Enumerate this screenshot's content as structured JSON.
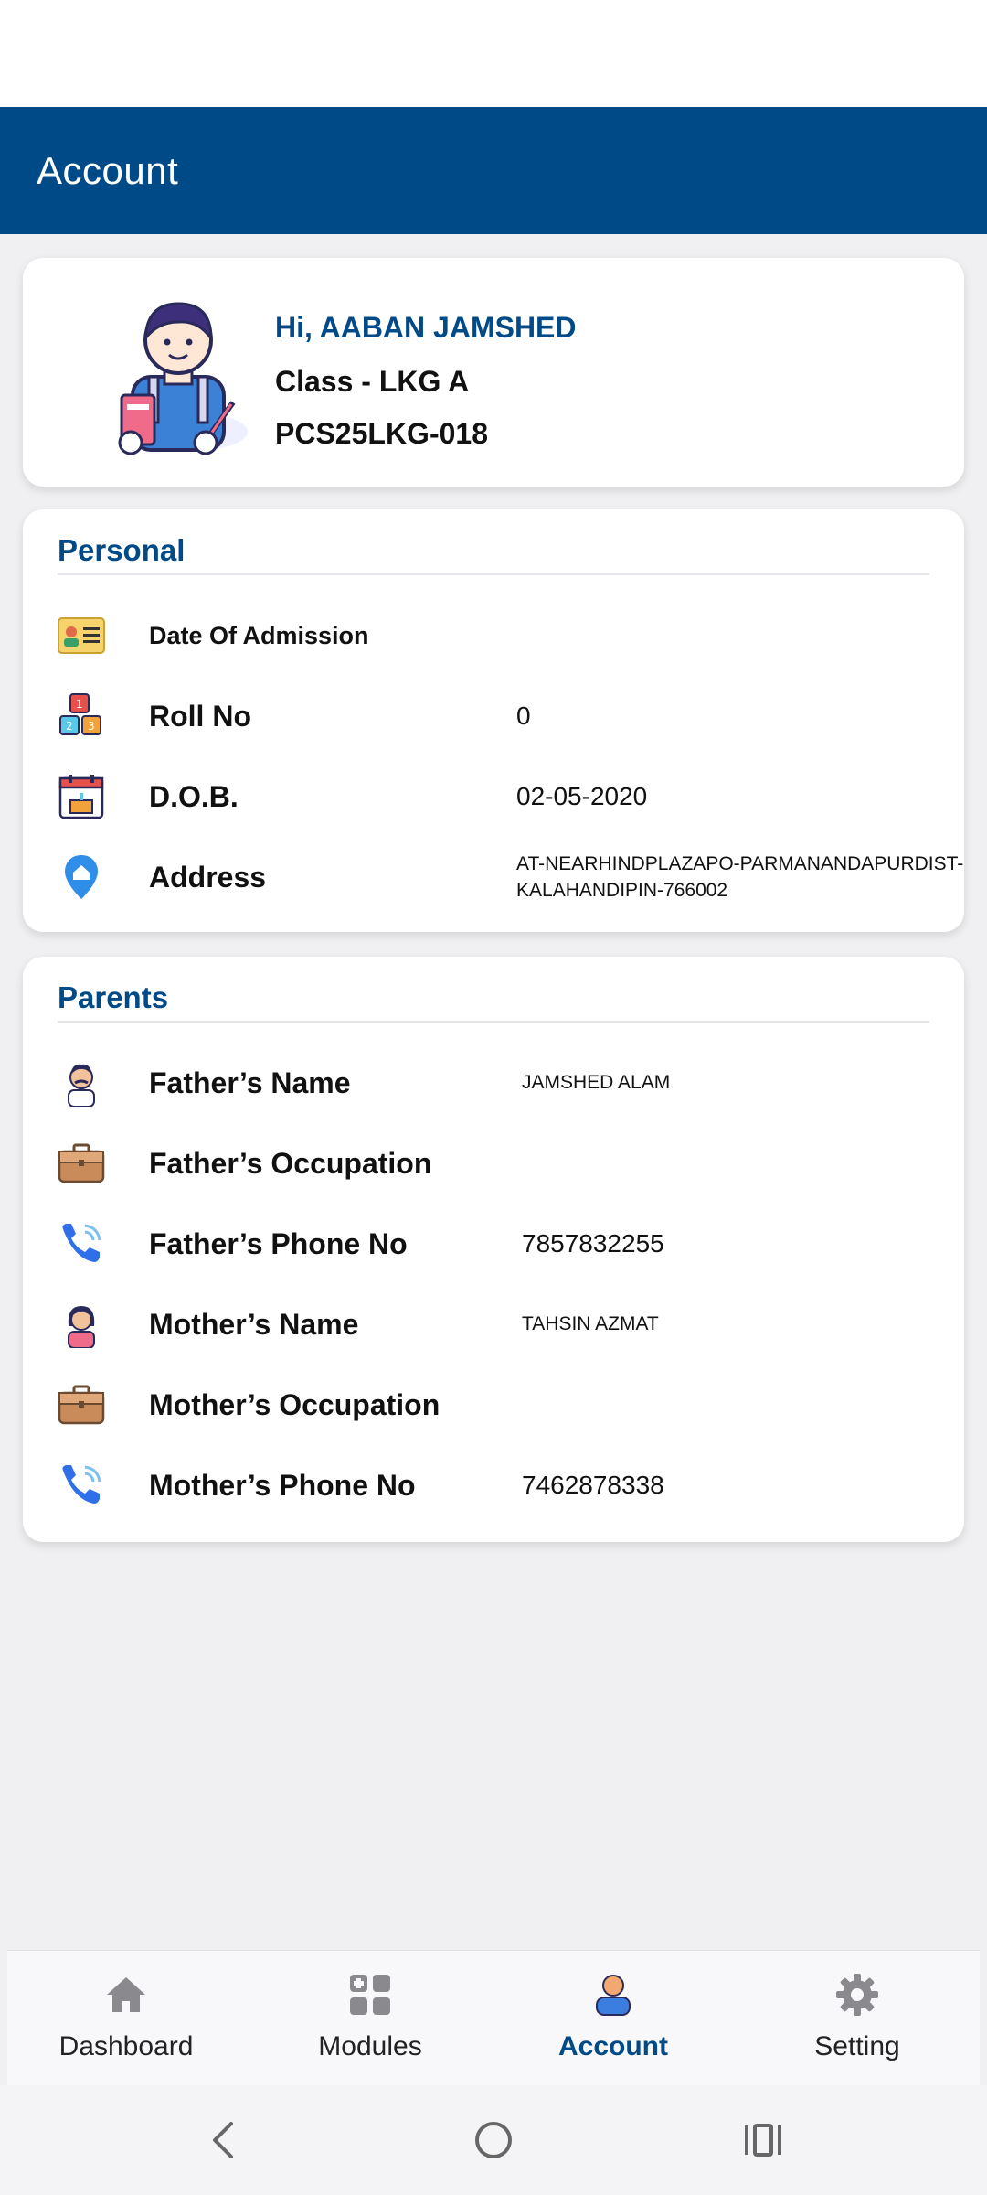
{
  "header": {
    "title": "Account"
  },
  "profile": {
    "greeting": "Hi, AABAN JAMSHED",
    "class_line": "Class - LKG A",
    "admission_code": "PCS25LKG-018"
  },
  "personal": {
    "title": "Personal",
    "rows": [
      {
        "label": "Date Of Admission",
        "value": ""
      },
      {
        "label": "Roll No",
        "value": "0"
      },
      {
        "label": "D.O.B.",
        "value": "02-05-2020"
      },
      {
        "label": "Address",
        "value": "AT-NEARHINDPLAZAPO-PARMANANDAPURDIST-KALAHANDIPIN-766002"
      }
    ]
  },
  "parents": {
    "title": "Parents",
    "rows": [
      {
        "label": "Father’s Name",
        "value": "JAMSHED ALAM"
      },
      {
        "label": "Father’s Occupation",
        "value": ""
      },
      {
        "label": "Father’s Phone No",
        "value": "7857832255"
      },
      {
        "label": "Mother’s Name",
        "value": "TAHSIN AZMAT"
      },
      {
        "label": "Mother’s Occupation",
        "value": ""
      },
      {
        "label": "Mother’s Phone No",
        "value": "7462878338"
      }
    ]
  },
  "bottom_nav": {
    "items": [
      {
        "label": "Dashboard",
        "icon": "home-icon",
        "active": false
      },
      {
        "label": "Modules",
        "icon": "grid-icon",
        "active": false
      },
      {
        "label": "Account",
        "icon": "user-icon",
        "active": true
      },
      {
        "label": "Setting",
        "icon": "gear-icon",
        "active": false
      }
    ]
  },
  "colors": {
    "primary": "#004a88",
    "background": "#f0f0f2",
    "card": "#ffffff"
  }
}
